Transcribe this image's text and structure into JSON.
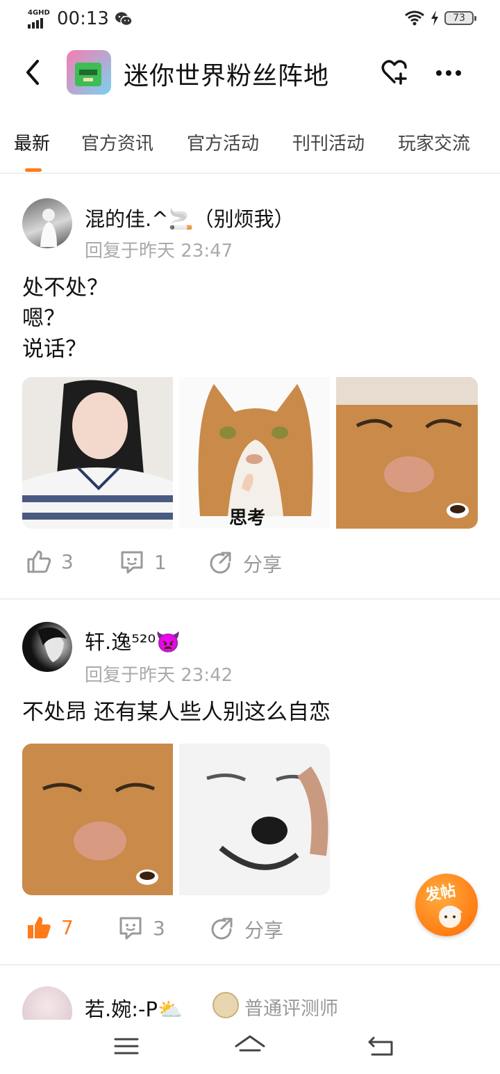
{
  "status_bar": {
    "network": "4GHD",
    "time": "00:13",
    "battery": "73"
  },
  "header": {
    "title": "迷你世界粉丝阵地"
  },
  "tabs": [
    {
      "label": "最新",
      "active": true
    },
    {
      "label": "官方资讯"
    },
    {
      "label": "官方活动"
    },
    {
      "label": "刊刊活动"
    },
    {
      "label": "玩家交流"
    }
  ],
  "posts": [
    {
      "username": "混的佳.^🚬（别烦我）",
      "time": "回复于昨天 23:47",
      "content": [
        "处不处？",
        "嗯？",
        "说话？"
      ],
      "image_caption": "思考",
      "likes": "3",
      "comments": "1",
      "share": "分享",
      "liked": false
    },
    {
      "username": "轩.逸⁵²⁰👿",
      "time": "回复于昨天 23:42",
      "content": [
        "不处昂 还有某人些人别这么自恋"
      ],
      "likes": "7",
      "comments": "3",
      "share": "分享",
      "liked": true
    },
    {
      "username": "若.婉:-P⛅",
      "badge": "普通评测师"
    }
  ],
  "fab": {
    "label": "发帖"
  },
  "colors": {
    "accent": "#ff7a1a",
    "muted": "#999999"
  }
}
